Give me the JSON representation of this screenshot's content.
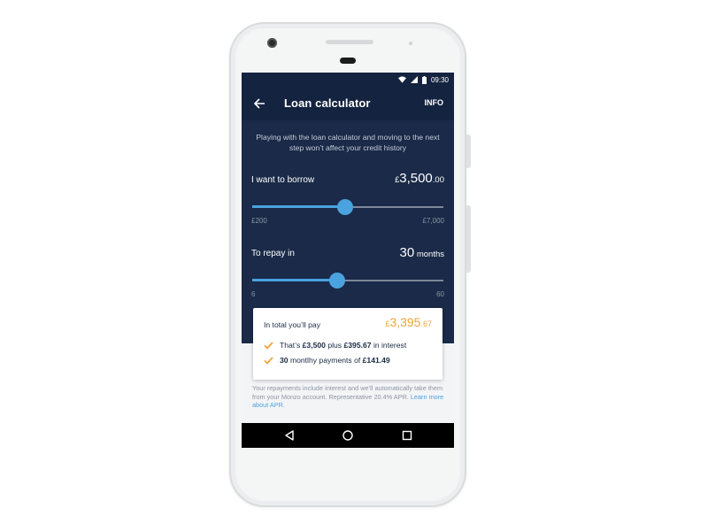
{
  "status_bar": {
    "time": "09:30",
    "icons": [
      "wifi-icon",
      "signal-icon",
      "battery-icon"
    ]
  },
  "app_bar": {
    "title": "Loan calculator",
    "info_label": "INFO",
    "back_icon": "arrow-left-icon"
  },
  "notice": "Playing with the loan calculator and moving to the next step won’t affect your credit history",
  "borrow": {
    "label": "I want to borrow",
    "currency": "£",
    "amount_main": "3,500",
    "amount_decimals": ".00",
    "min_label": "£200",
    "max_label": "£7,000",
    "value": 3500,
    "min": 200,
    "max": 7000
  },
  "repay": {
    "label": "To repay in",
    "amount_main": "30",
    "unit": " months",
    "min_label": "6",
    "max_label": "60",
    "value": 30,
    "min": 6,
    "max": 60
  },
  "summary": {
    "label": "In total you’ll pay",
    "currency": "£",
    "amount_main": "3,395",
    "amount_decimals": ".67",
    "line1": {
      "prefix": "That’s ",
      "principal": "£3,500",
      "mid": " plus ",
      "interest": "£395.67",
      "suffix": " in interest"
    },
    "line2": {
      "count": "30",
      "mid": " montlhy payments of ",
      "payment": "£141.49"
    }
  },
  "footnote": {
    "text": "Your repayments include interest and we’ll automatically take them from your Monzo account. Representative 20.4% APR.",
    "link": "Learn more about APR."
  },
  "nav": {
    "back": "nav-back-icon",
    "home": "nav-home-icon",
    "recents": "nav-recents-icon"
  },
  "colors": {
    "header": "#14233f",
    "body": "#1a2a48",
    "accent": "#4aa3df",
    "orange": "#f0a33a",
    "check": "#f0a33a"
  }
}
